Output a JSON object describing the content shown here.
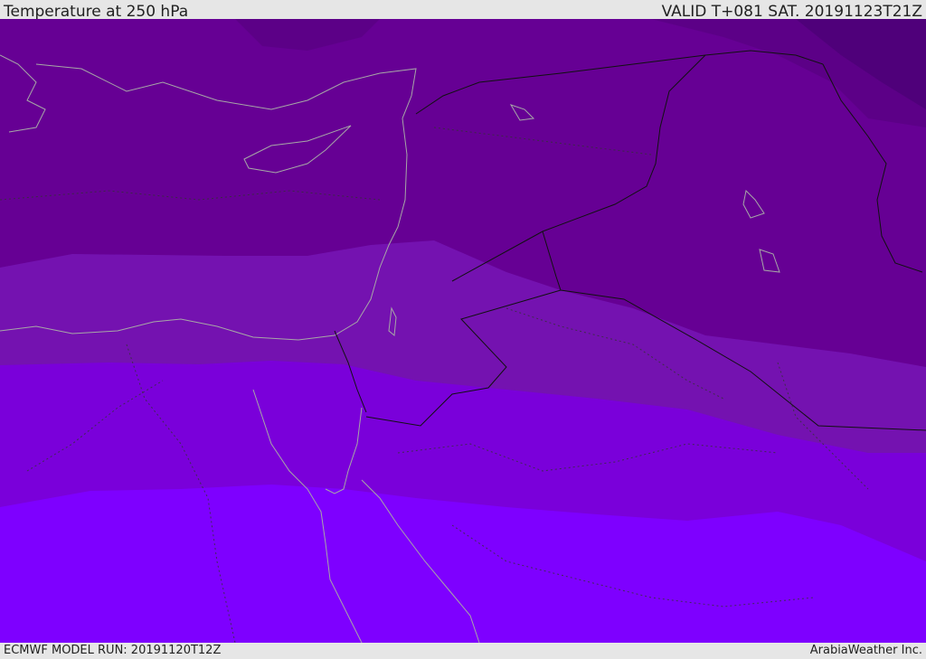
{
  "header": {
    "title": "Temperature at 250 hPa",
    "valid": "VALID T+081 SAT. 20191123T21Z"
  },
  "footer": {
    "model_run": "ECMWF MODEL RUN: 20191120T12Z",
    "credit": "ArabiaWeather Inc."
  },
  "colors": {
    "band_1": "#4f007a",
    "band_2": "#5c0087",
    "band_3": "#660094",
    "band_4": "#7412b0",
    "band_5": "#7a00da",
    "band_6": "#7e00ff",
    "coast": "#a7a7a7",
    "border": "#111111"
  }
}
